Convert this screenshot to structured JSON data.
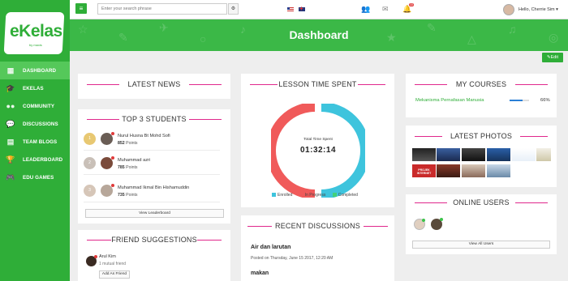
{
  "brand": {
    "name": "eKelas",
    "sub": "by maxis"
  },
  "sidebar": {
    "items": [
      {
        "label": "DASHBOARD",
        "icon": "grid-icon"
      },
      {
        "label": "EKELAS",
        "icon": "graduation-cap-icon"
      },
      {
        "label": "COMMUNITY",
        "icon": "users-icon"
      },
      {
        "label": "DISCUSSIONS",
        "icon": "chat-icon"
      },
      {
        "label": "TEAM BLOGS",
        "icon": "blog-icon"
      },
      {
        "label": "LEADERBOARD",
        "icon": "trophy-icon"
      },
      {
        "label": "EDU GAMES",
        "icon": "gamepad-icon"
      }
    ]
  },
  "topbar": {
    "search_placeholder": "Enter your search phrase",
    "notification_count": "10",
    "greeting": "Hello, Cherrie Sim"
  },
  "banner": {
    "title": "Dashboard"
  },
  "edit_label": "Edit",
  "latest_news": {
    "title": "LATEST NEWS"
  },
  "top_students": {
    "title": "TOP 3 STUDENTS",
    "students": [
      {
        "rank": "1",
        "name": "Nurul Husna Bt Mohd Sofi",
        "points": "852",
        "unit": "Points"
      },
      {
        "rank": "2",
        "name": "Muhammad azri",
        "points": "785",
        "unit": "Points"
      },
      {
        "rank": "3",
        "name": "Muhammad Ikmal Bin Hishamuddin",
        "points": "735",
        "unit": "Points"
      }
    ],
    "button": "View Leaderboard"
  },
  "friend_suggestions": {
    "title": "FRIEND SUGGESTIONS",
    "friend": {
      "name": "Arul Kim",
      "mutual": "1 mutual friend",
      "button": "Add As Friend"
    }
  },
  "lesson_time": {
    "title": "LESSON TIME SPENT",
    "center_label": "Total Time Spent",
    "center_value": "01:32:14",
    "legend": [
      {
        "label": "Enrolled",
        "color": "#3ec4dd"
      },
      {
        "label": "In Progress",
        "color": "#f05a5a"
      },
      {
        "label": "Completed",
        "color": "#42d17a"
      }
    ]
  },
  "recent_discussions": {
    "title": "RECENT DISCUSSIONS",
    "items": [
      {
        "title": "Air dan larutan",
        "date": "Posted on Thursday, June 15 2017, 12:20 AM"
      },
      {
        "title": "makan",
        "date": ""
      }
    ]
  },
  "my_courses": {
    "title": "MY COURSES",
    "courses": [
      {
        "name": "Mekanisma Pernafasan Manusia",
        "progress": 0.66,
        "percent": "66%"
      }
    ]
  },
  "latest_photos": {
    "title": "LATEST PHOTOS",
    "captions": [
      "PROJEK INTERNET"
    ]
  },
  "online_users": {
    "title": "ONLINE USERS",
    "button": "View All Users"
  },
  "colors": {
    "brand_green": "#2fae38",
    "accent_pink": "#e0288c"
  }
}
